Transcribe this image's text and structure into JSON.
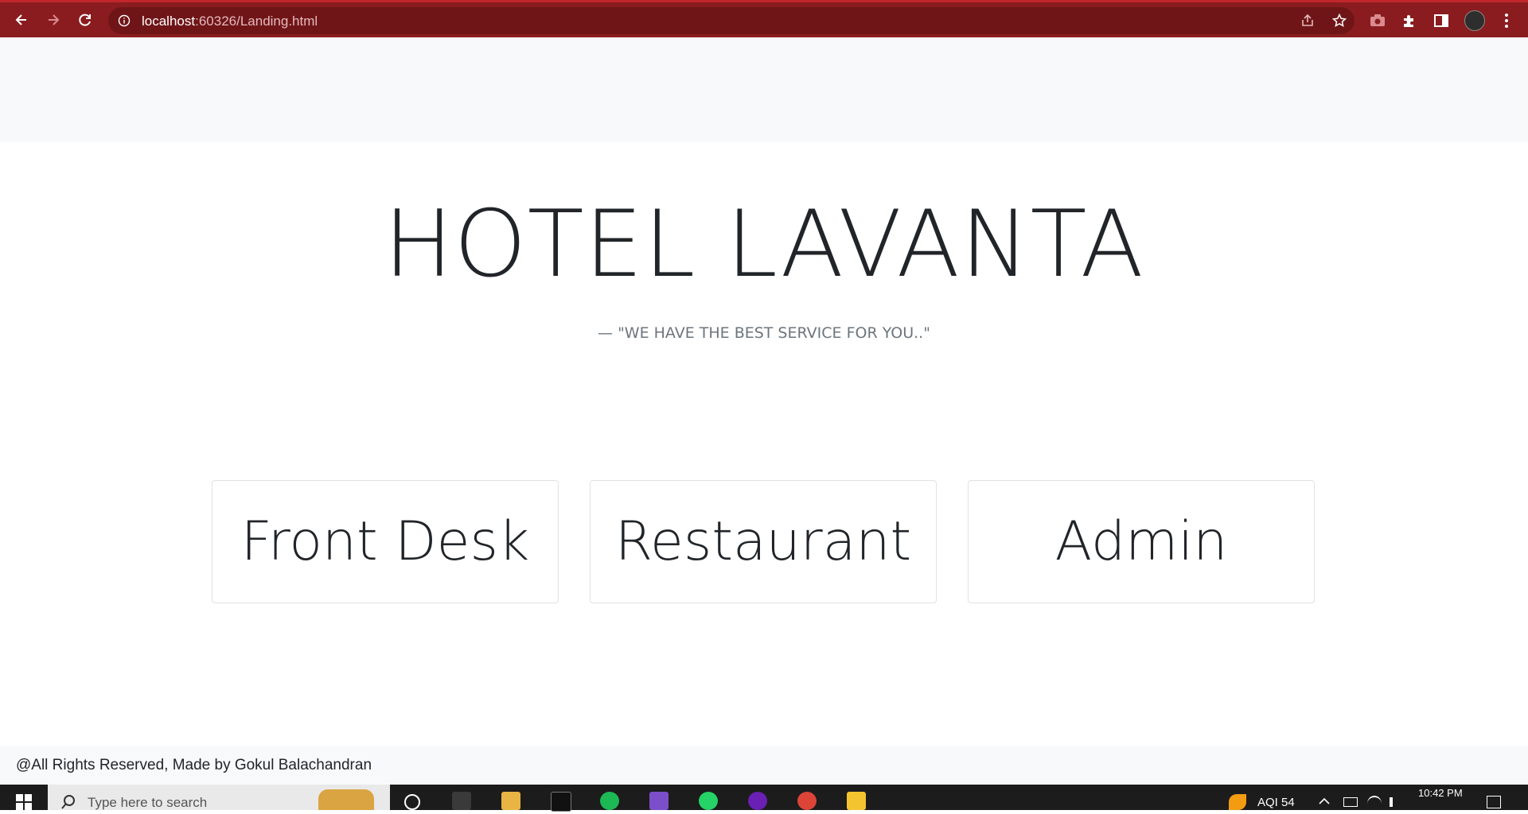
{
  "browser": {
    "url_host": "localhost",
    "url_path": ":60326/Landing.html"
  },
  "page": {
    "title": "HOTEL LAVANTA",
    "tagline": "— \"WE HAVE THE BEST SERVICE FOR YOU..\"",
    "cards": [
      {
        "label": "Front Desk"
      },
      {
        "label": "Restaurant"
      },
      {
        "label": "Admin"
      }
    ],
    "footer": "@All Rights Reserved, Made by Gokul Balachandran"
  },
  "taskbar": {
    "search_placeholder": "Type here to search",
    "aqi": "AQI 54",
    "time": "10:42 PM"
  },
  "colors": {
    "browser_bar": "#8a1c1f",
    "page_bg": "#ffffff",
    "navbar_bg": "#f8f9fa",
    "text": "#212529"
  }
}
